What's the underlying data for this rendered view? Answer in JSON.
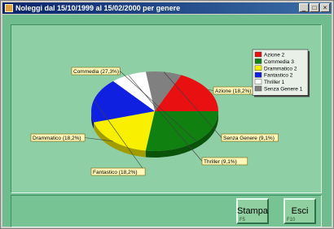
{
  "window": {
    "title": "Noleggi dal 15/10/1999 al 15/02/2000 per genere"
  },
  "buttons": {
    "stampa_label": "Stampa",
    "esci_label": "Esci",
    "stampa_key": "F5",
    "esci_key": "F10"
  },
  "chart_data": {
    "type": "pie",
    "slices": [
      {
        "name": "Azione 2",
        "value": 18.2,
        "label": "Azione (18,2%)",
        "color": "#e81010"
      },
      {
        "name": "Senza Genere 1",
        "value": 9.1,
        "label": "Senza Genere (9,1%)",
        "color": "#808080"
      },
      {
        "name": "Thriller 1",
        "value": 9.1,
        "label": "Thriller (9,1%)",
        "color": "#ffffff"
      },
      {
        "name": "Fantastico 2",
        "value": 18.2,
        "label": "Fantastico (18,2%)",
        "color": "#1020e0"
      },
      {
        "name": "Drammatico 2",
        "value": 18.2,
        "label": "Drammatico (18,2%)",
        "color": "#f8f000"
      },
      {
        "name": "Commedia 3",
        "value": 27.3,
        "label": "Commedia (27,3%)",
        "color": "#108010"
      }
    ],
    "legend": [
      {
        "name": "Azione 2",
        "color": "#e81010"
      },
      {
        "name": "Commedia 3",
        "color": "#108010"
      },
      {
        "name": "Drammatico 2",
        "color": "#f8f000"
      },
      {
        "name": "Fantastico 2",
        "color": "#1020e0"
      },
      {
        "name": "Thriller 1",
        "color": "#ffffff"
      },
      {
        "name": "Senza Genere 1",
        "color": "#808080"
      }
    ],
    "legend_position": "top-right"
  }
}
